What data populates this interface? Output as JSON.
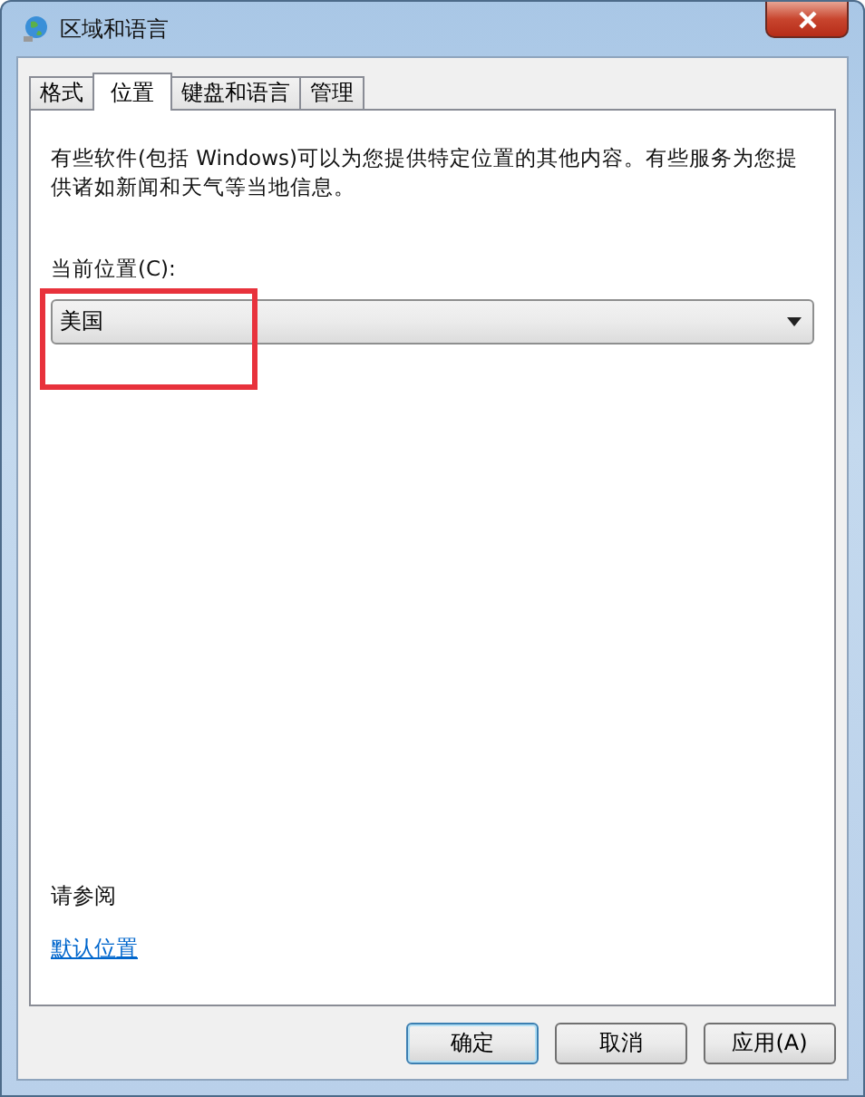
{
  "window": {
    "title": "区域和语言"
  },
  "tabs": [
    {
      "label": "格式",
      "selected": false
    },
    {
      "label": "位置",
      "selected": true
    },
    {
      "label": "键盘和语言",
      "selected": false
    },
    {
      "label": "管理",
      "selected": false
    }
  ],
  "description": "有些软件(包括 Windows)可以为您提供特定位置的其他内容。有些服务为您提供诸如新闻和天气等当地信息。",
  "location": {
    "label": "当前位置(C):",
    "value": "美国",
    "highlighted": true
  },
  "see_also": {
    "heading": "请参阅",
    "link": "默认位置"
  },
  "buttons": [
    {
      "label": "确定",
      "default": true
    },
    {
      "label": "取消",
      "default": false
    },
    {
      "label": "应用(A)",
      "default": false
    }
  ]
}
